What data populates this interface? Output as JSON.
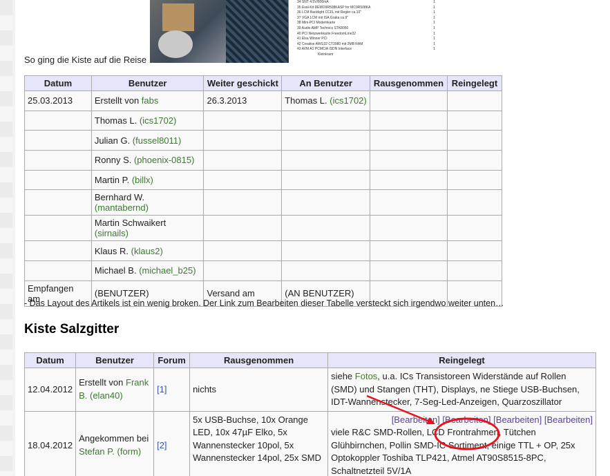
{
  "top_caption": "So ging die Kiste auf die Reise",
  "spreadsheet_rows": [
    [
      "34 SNT 4.5V/800mA",
      "1"
    ],
    [
      "35 Eval-Kit DEMO9R508KASP for MC9R508KA",
      "1"
    ],
    [
      "36 LCM Backlight CCFL mit Regler ca.10\"",
      "1"
    ],
    [
      "37 VGA LCM mit ISA Graka ca.9\"",
      "1"
    ],
    [
      "38 Mini-PCI Modemkarte",
      "1"
    ],
    [
      "39 Audio AMP Technics STK8050",
      "1"
    ],
    [
      "40 PCI Netzwerkkarte FreedomLine32",
      "1"
    ],
    [
      "41 Elsa Winner PCI",
      "1"
    ],
    [
      "42 Creative AWG32 CT3980 mit 2MB RAM",
      "1"
    ],
    [
      "43 AVM A1 PCMCIA ISDN Interface",
      "1"
    ],
    [
      "",
      ""
    ],
    [
      "Kleinkram",
      ""
    ]
  ],
  "table1": {
    "headers": [
      "Datum",
      "Benutzer",
      "Weiter geschickt",
      "An Benutzer",
      "Rausgenommen",
      "Reingelegt"
    ],
    "first_row": {
      "date": "25.03.2013",
      "user_prefix": "Erstellt von ",
      "user_link": "fabs",
      "sent": "26.3.2013",
      "to_name": "Thomas L. ",
      "to_link": "(ics1702)"
    },
    "users": [
      {
        "name": "Thomas L. ",
        "nick": "(ics1702)"
      },
      {
        "name": "Julian G. ",
        "nick": "(fussel8011)"
      },
      {
        "name": "Ronny S. ",
        "nick": "(phoenix-0815)"
      },
      {
        "name": "Martin P. ",
        "nick": "(billx)"
      },
      {
        "name": "Bernhard W. ",
        "nick": "(mantabernd)"
      },
      {
        "name": "Martin Schwaikert ",
        "nick": "(sirnails)"
      },
      {
        "name": "Klaus R. ",
        "nick": "(klaus2)"
      },
      {
        "name": "Michael B. ",
        "nick": "(michael_b25)"
      }
    ],
    "last_row": {
      "c1": "Empfangen am",
      "c2": "(BENUTZER)",
      "c3": "Versand am",
      "c4": "(AN BENUTZER)"
    }
  },
  "note": "- Das Layout des Artikels ist ein wenig broken. Der Link zum Bearbeiten dieser Tabelle versteckt sich irgendwo weiter unten…",
  "section_heading": "Kiste Salzgitter",
  "table2": {
    "headers": [
      "Datum",
      "Benutzer",
      "Forum",
      "Rausgenommen",
      "Reingelegt"
    ],
    "row1": {
      "date": "12.04.2012",
      "user_prefix": "Erstellt von ",
      "user_link": "Frank B.",
      "user_nick": "(elan40)",
      "forum": "[1]",
      "out": "nichts",
      "in_prefix": "siehe ",
      "in_link": "Fotos",
      "in_text": ", u.a. ICs Transistoreen Widerstände auf Rollen (SMD) und Stangen (THT), Displays, ne Stiege USB-Buchsen, IDT-Wannenstecker, 7-Seg-Led-Anzeigen, Quarzoszillator"
    },
    "row2": {
      "date": "18.04.2012",
      "user_prefix": "Angekommen bei ",
      "user_link": "Stefan P.",
      "user_nick": "(form)",
      "forum": "[2]",
      "out": "5x USB-Buchse, 10x Orange LED, 10x 47µF Elko, 5x Wannenstecker 10pol, 5x Wannenstecker 14pol, 25x SMD",
      "edit_links": [
        "[Bearbeiten]",
        "[Bearbeiten]",
        "[Bearbeiten]",
        "[Bearbeiten]"
      ],
      "in_text": "viele R&C SMD-Rollen, LCD Frontrahmen, Tütchen Glühbirnchen, Pollin SMD-IC Sortiment, einige TTL + OP, 25x Optokoppler Toshiba TLP421, Atmel AT90S8515-8PC, Schaltnetzteil 5V/1A"
    }
  },
  "colors": {
    "link": "#3b7a2f",
    "header_bg": "#e6e6fa",
    "annotation_red": "#e8121c"
  }
}
